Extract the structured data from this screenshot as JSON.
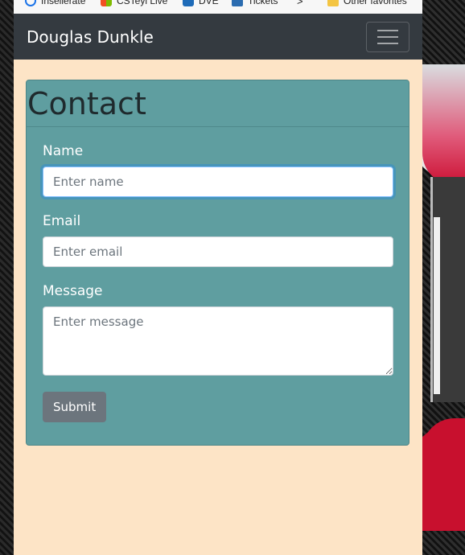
{
  "favorites": {
    "items": [
      {
        "label": "Insellerate",
        "icon": "browser-icon"
      },
      {
        "label": "CSTeyl Live",
        "icon": "windows-icon"
      },
      {
        "label": "DVE",
        "icon": "app-icon"
      },
      {
        "label": "Tickets",
        "icon": "person-icon"
      },
      {
        "label": "Other favorites",
        "icon": "folder-icon"
      }
    ]
  },
  "navbar": {
    "brand": "Douglas Dunkle",
    "toggler_icon": "hamburger-icon"
  },
  "contact": {
    "title": "Contact",
    "name_label": "Name",
    "name_placeholder": "Enter name",
    "email_label": "Email",
    "email_placeholder": "Enter email",
    "message_label": "Message",
    "message_placeholder": "Enter message",
    "submit_label": "Submit"
  },
  "colors": {
    "navbar": "#343a40",
    "page_bg": "#fde4c6",
    "card_bg": "#5f9ea0",
    "button": "#6c757d"
  }
}
